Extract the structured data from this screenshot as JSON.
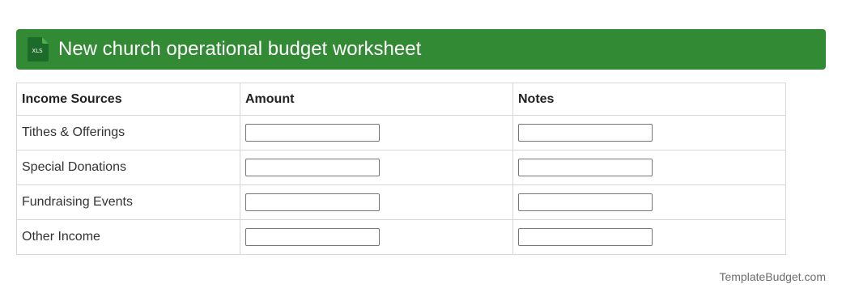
{
  "header": {
    "title": "New church operational budget worksheet",
    "icon": "xls-file-icon",
    "icon_text": "XLS",
    "background_color": "#338a35"
  },
  "table": {
    "columns": [
      "Income Sources",
      "Amount",
      "Notes"
    ],
    "rows": [
      {
        "source": "Tithes & Offerings",
        "amount": "",
        "notes": ""
      },
      {
        "source": "Special Donations",
        "amount": "",
        "notes": ""
      },
      {
        "source": "Fundraising Events",
        "amount": "",
        "notes": ""
      },
      {
        "source": "Other Income",
        "amount": "",
        "notes": ""
      }
    ]
  },
  "footer": {
    "brand": "TemplateBudget.com"
  }
}
